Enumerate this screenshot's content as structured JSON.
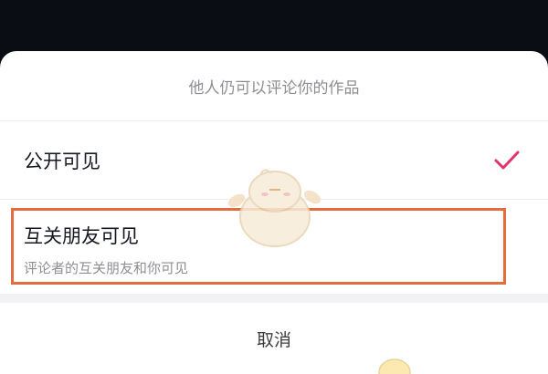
{
  "sheet": {
    "header_text": "他人仍可以评论你的作品",
    "options": [
      {
        "label": "公开可见",
        "selected": true
      },
      {
        "label": "互关朋友可见",
        "sublabel": "评论者的互关朋友和你可见",
        "selected": false,
        "highlighted": true
      }
    ],
    "cancel_label": "取消"
  },
  "colors": {
    "checkmark": "#e0336a",
    "highlight_border": "#e36d3f",
    "backdrop": "#0b0d14"
  },
  "icons": {
    "selected_indicator": "checkmark-icon",
    "watermark": "chick-mascot-icon"
  }
}
